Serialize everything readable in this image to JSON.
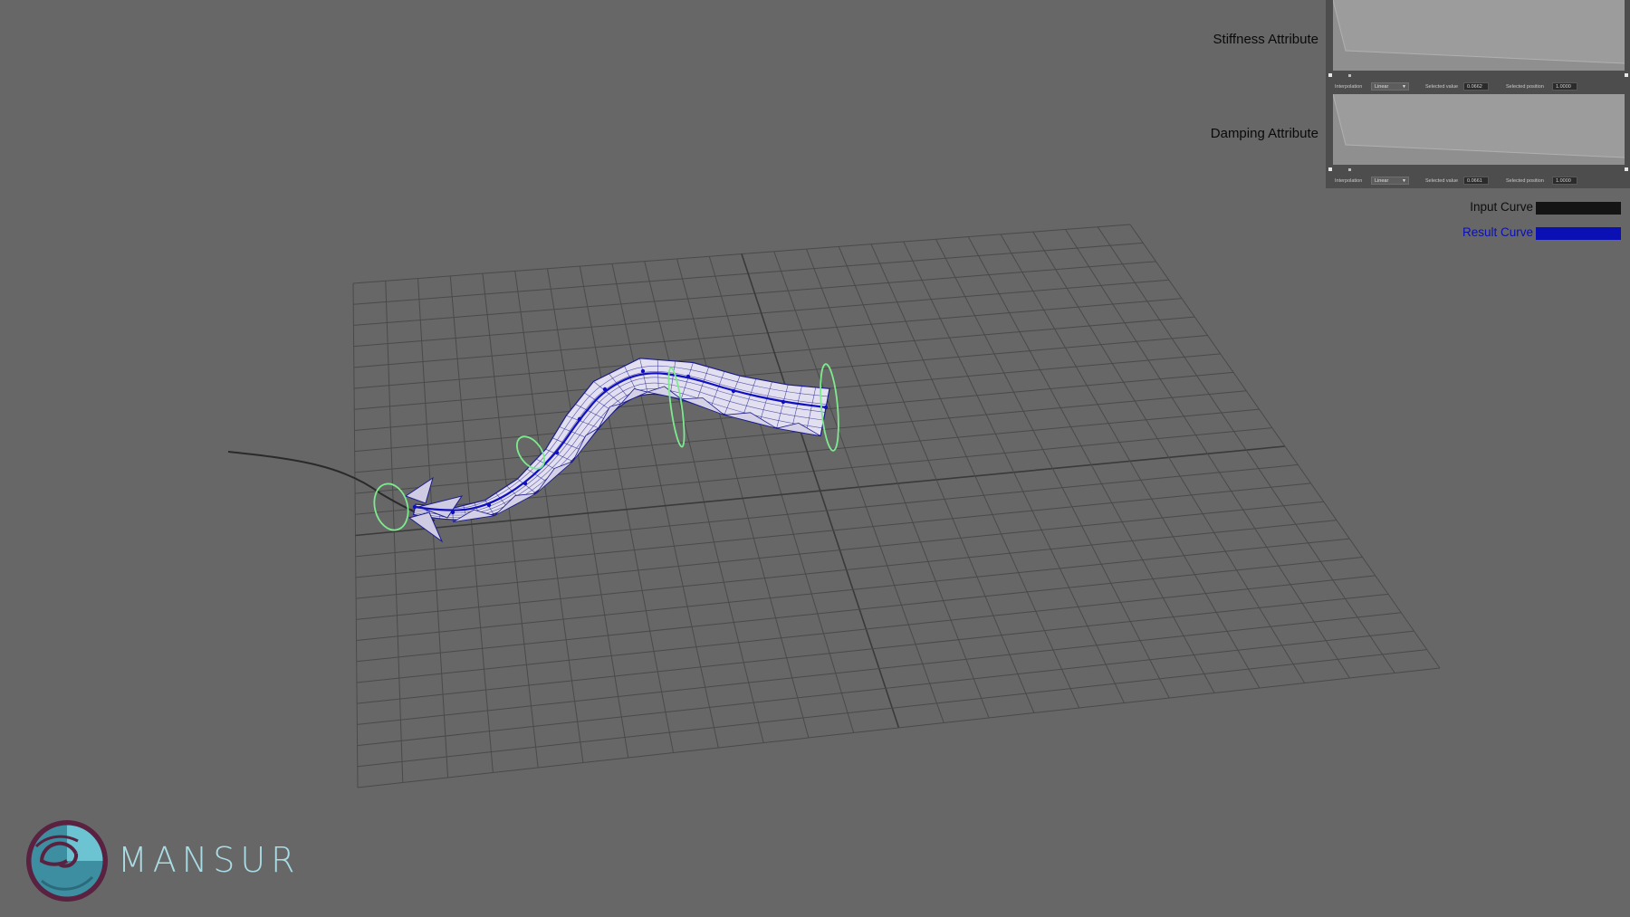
{
  "viewport": {
    "background": "#676767",
    "grid_color": "#4a4a4a",
    "axis_color": "#3a3a3a",
    "mesh_fill": "#e2dff0",
    "mesh_wire": "#1c1c8c",
    "result_curve_color": "#1010c0",
    "input_curve_color": "#2a2a2a",
    "control_ring_color": "#7eea8e"
  },
  "attributes": {
    "stiffness": {
      "label": "Stiffness Attribute",
      "interpolation_label": "Interpolation",
      "interpolation_value": "Linear",
      "selected_value_label": "Selected value",
      "selected_value": "0.0662",
      "selected_position_label": "Selected position",
      "selected_position": "1.0000"
    },
    "damping": {
      "label": "Damping Attribute",
      "interpolation_label": "Interpolation",
      "interpolation_value": "Linear",
      "selected_value_label": "Selected value",
      "selected_value": "0.0661",
      "selected_position_label": "Selected position",
      "selected_position": "1.0000"
    }
  },
  "legend": {
    "input_curve": {
      "label": "Input Curve",
      "color": "#141414"
    },
    "result_curve": {
      "label": "Result Curve",
      "color": "#0a10b4"
    }
  },
  "logo": {
    "text": "MANSUR",
    "text_color": "#a9dce4",
    "icon": "spiral-shell-icon"
  }
}
